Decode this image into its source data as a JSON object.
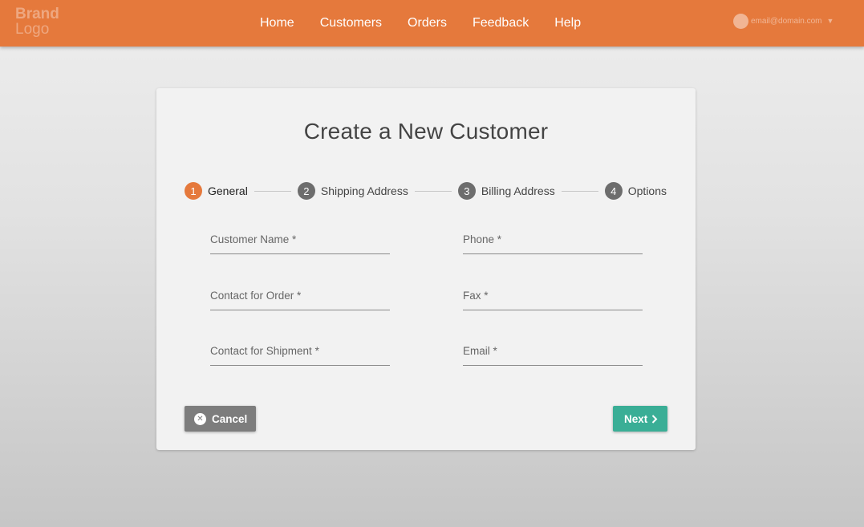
{
  "header": {
    "brand_line1": "Brand",
    "brand_line2": "Logo",
    "nav": [
      {
        "label": "Home"
      },
      {
        "label": "Customers"
      },
      {
        "label": "Orders"
      },
      {
        "label": "Feedback"
      },
      {
        "label": "Help"
      }
    ],
    "account_email": "email@domain.com",
    "accent_color": "#e5793c"
  },
  "form": {
    "title": "Create a New Customer",
    "steps": [
      {
        "num": "1",
        "label": "General",
        "active": true
      },
      {
        "num": "2",
        "label": "Shipping Address",
        "active": false
      },
      {
        "num": "3",
        "label": "Billing Address",
        "active": false
      },
      {
        "num": "4",
        "label": "Options",
        "active": false
      }
    ],
    "fields": {
      "customer_name": "Customer Name *",
      "phone": "Phone *",
      "contact_order": "Contact for Order *",
      "fax": "Fax *",
      "contact_shipment": "Contact for Shipment *",
      "email": "Email *"
    },
    "buttons": {
      "cancel": "Cancel",
      "next": "Next",
      "next_color": "#3aae96",
      "cancel_color": "#7d7d7d"
    }
  }
}
